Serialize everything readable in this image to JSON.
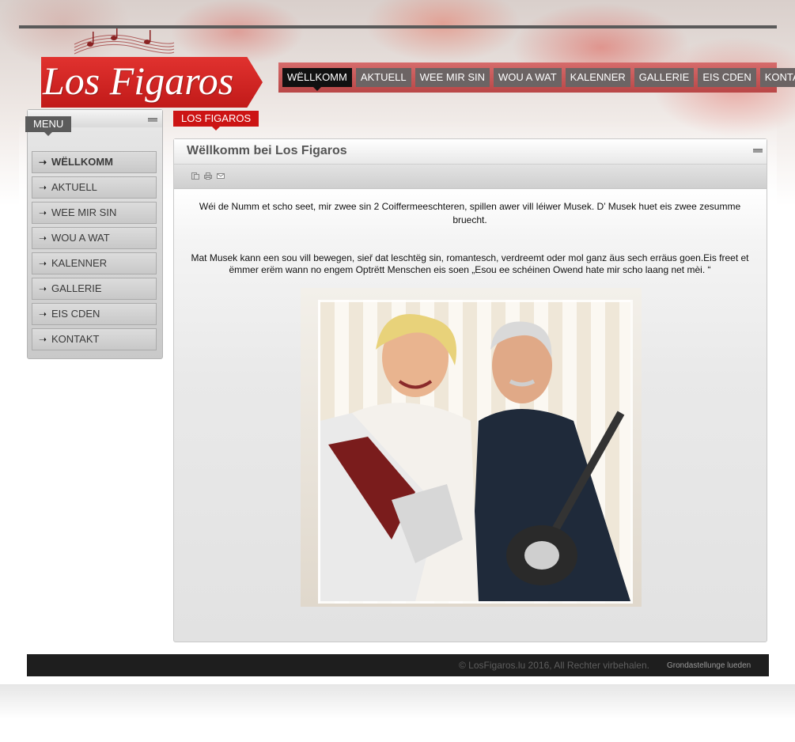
{
  "logo": {
    "text": "Los Figaros"
  },
  "topnav": {
    "items": [
      {
        "label": "WËLLKOMM",
        "active": true
      },
      {
        "label": "AKTUELL",
        "active": false
      },
      {
        "label": "WEE MIR SIN",
        "active": false
      },
      {
        "label": "WOU A WAT",
        "active": false
      },
      {
        "label": "KALENNER",
        "active": false
      },
      {
        "label": "GALLERIE",
        "active": false
      },
      {
        "label": "EIS CDEN",
        "active": false
      },
      {
        "label": "KONTAKT",
        "active": false
      }
    ]
  },
  "sidebar": {
    "title": "MENU",
    "items": [
      {
        "label": "WËLLKOMM",
        "active": true
      },
      {
        "label": "AKTUELL",
        "active": false
      },
      {
        "label": "WEE MIR SIN",
        "active": false
      },
      {
        "label": "WOU A WAT",
        "active": false
      },
      {
        "label": "KALENNER",
        "active": false
      },
      {
        "label": "GALLERIE",
        "active": false
      },
      {
        "label": "EIS CDEN",
        "active": false
      },
      {
        "label": "KONTAKT",
        "active": false
      }
    ]
  },
  "breadcrumb": {
    "label": "LOS FIGAROS"
  },
  "article": {
    "title": "Wëllkomm bei Los Figaros",
    "tools": [
      "pdf-icon",
      "print-icon",
      "email-icon"
    ],
    "paragraph1": "Wéi de Numm et scho seet, mir zwee sin 2 Coiffermeeschteren, spillen awer vill léiwer Musek. D’   Musek huet eis zwee zesumme bruecht.",
    "paragraph2": "Mat Musek kann een sou vill bewegen, sieř dat leschtëg sin, romantesch, verdreemt oder mol ganz äus sech erräus goen.Eis freet et ëmmer erëm wann no engem Optrëtt Menschen eis soen „Esou ee schéinen Owend hate mir scho laang net mèi.  “"
  },
  "footer": {
    "copyright": "© LosFigaros.lu 2016, All Rechter virbehalen.",
    "link": "Grondastellunge lueden"
  },
  "colors": {
    "brand_red": "#cc1414",
    "nav_bar": "#b94747",
    "nav_item": "#6c6464",
    "nav_active": "#111111",
    "footer": "#1e1e1e"
  }
}
